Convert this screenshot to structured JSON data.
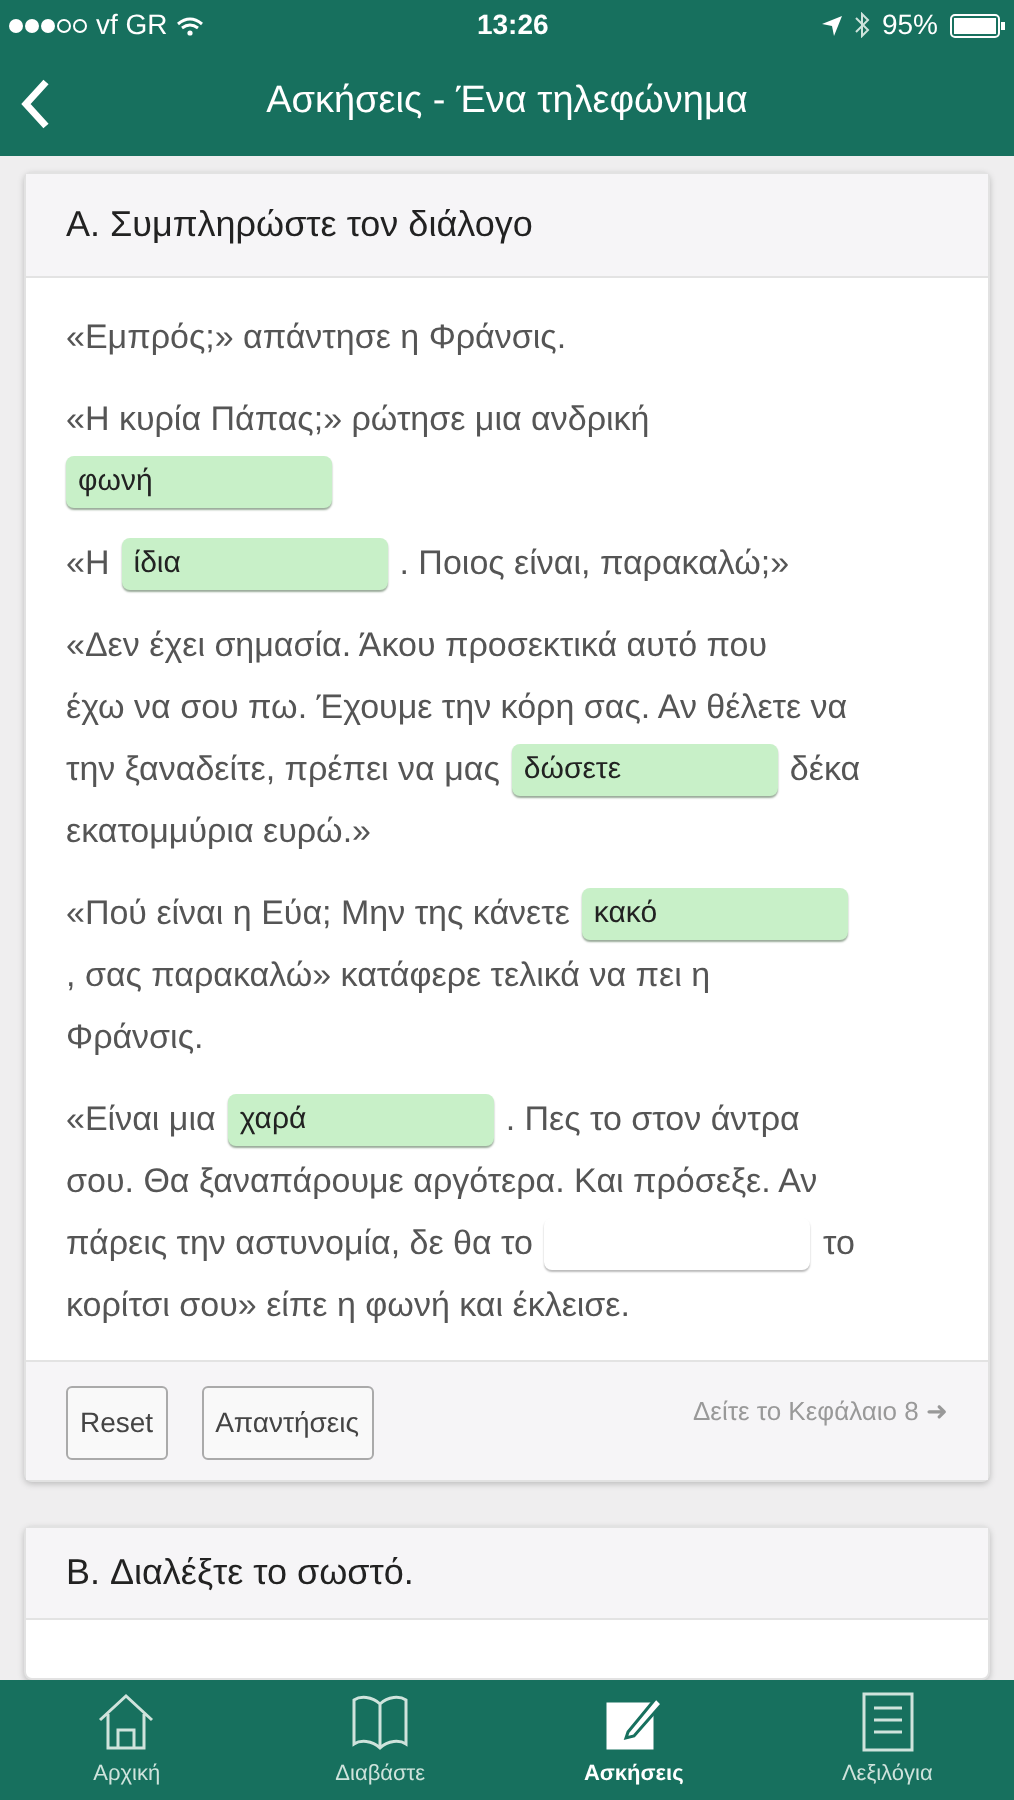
{
  "status_bar": {
    "carrier": "vf GR",
    "time": "13:26",
    "battery": "95%"
  },
  "nav": {
    "title": "Ασκήσεις - Ένα τηλεφώνημα"
  },
  "section_a": {
    "title": "A. Συμπληρώστε τον διάλογο",
    "paragraphs": [
      {
        "lines": [
          [
            {
              "kind": "text",
              "text": "«Εμπρός;» απάντησε η Φράνσις."
            }
          ]
        ]
      },
      {
        "lines": [
          [
            {
              "kind": "text",
              "text": "«Η κυρία Πάπας;» ρώτησε μια ανδρική"
            }
          ],
          [
            {
              "kind": "blank",
              "value": "φωνή",
              "correct": true
            }
          ]
        ]
      },
      {
        "lines": [
          [
            {
              "kind": "text",
              "text": "«Η"
            },
            {
              "kind": "blank",
              "value": "ίδια",
              "correct": true
            },
            {
              "kind": "text",
              "text": ". Ποιος είναι, παρακαλώ;»"
            }
          ]
        ]
      },
      {
        "lines": [
          [
            {
              "kind": "text",
              "text": "«Δεν έχει σημασία. Άκου προσεκτικά αυτό που"
            }
          ],
          [
            {
              "kind": "text",
              "text": "έχω να σου πω. Έχουμε την κόρη σας. Αν θέλετε να"
            }
          ],
          [
            {
              "kind": "text",
              "text": "την ξαναδείτε, πρέπει να μας"
            },
            {
              "kind": "blank",
              "value": "δώσετε",
              "correct": true
            },
            {
              "kind": "text",
              "text": "δέκα"
            }
          ],
          [
            {
              "kind": "text",
              "text": "εκατομμύρια ευρώ.»"
            }
          ]
        ]
      },
      {
        "lines": [
          [
            {
              "kind": "text",
              "text": "«Πού είναι η Εύα; Μην της κάνετε"
            },
            {
              "kind": "blank",
              "value": "κακό",
              "correct": true
            }
          ],
          [
            {
              "kind": "text",
              "text": ", σας παρακαλώ» κατάφερε τελικά να πει η"
            }
          ],
          [
            {
              "kind": "text",
              "text": "Φράνσις."
            }
          ]
        ]
      },
      {
        "lines": [
          [
            {
              "kind": "text",
              "text": "«Είναι μια"
            },
            {
              "kind": "blank",
              "value": "χαρά",
              "correct": true
            },
            {
              "kind": "text",
              "text": ". Πες το στον άντρα"
            }
          ],
          [
            {
              "kind": "text",
              "text": "σου. Θα ξαναπάρουμε αργότερα. Και πρόσεξε. Αν"
            }
          ],
          [
            {
              "kind": "text",
              "text": "πάρεις την αστυνομία, δε θα το"
            },
            {
              "kind": "blank",
              "correct": false
            },
            {
              "kind": "text",
              "text": "το"
            }
          ],
          [
            {
              "kind": "text",
              "text": "κορίτσι σου» είπε η φωνή και έκλεισε."
            }
          ]
        ]
      }
    ],
    "buttons": [
      "Reset",
      "Απαντήσεις"
    ],
    "chapter_link": "Δείτε το Κεφάλαιο 8 ➜"
  },
  "section_b": {
    "title": "B. Διαλέξτε το σωστό."
  },
  "tabs": [
    {
      "label": "Αρχική",
      "selected": false
    },
    {
      "label": "Διαβάστε",
      "selected": false
    },
    {
      "label": "Ασκήσεις",
      "selected": true
    },
    {
      "label": "Λεξιλόγια",
      "selected": false
    }
  ]
}
